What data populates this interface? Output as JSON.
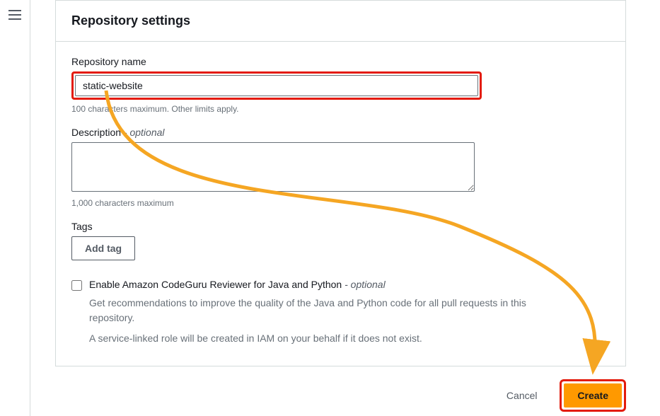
{
  "panel": {
    "title": "Repository settings"
  },
  "repo_name": {
    "label": "Repository name",
    "value": "static-website",
    "hint": "100 characters maximum. Other limits apply."
  },
  "description": {
    "label": "Description",
    "optional": "- optional",
    "value": "",
    "hint": "1,000 characters maximum"
  },
  "tags": {
    "label": "Tags",
    "add_button": "Add tag"
  },
  "codeguru": {
    "label": "Enable Amazon CodeGuru Reviewer for Java and Python",
    "optional": "- optional",
    "desc1": "Get recommendations to improve the quality of the Java and Python code for all pull requests in this repository.",
    "desc2": "A service-linked role will be created in IAM on your behalf if it does not exist."
  },
  "actions": {
    "cancel": "Cancel",
    "create": "Create"
  }
}
